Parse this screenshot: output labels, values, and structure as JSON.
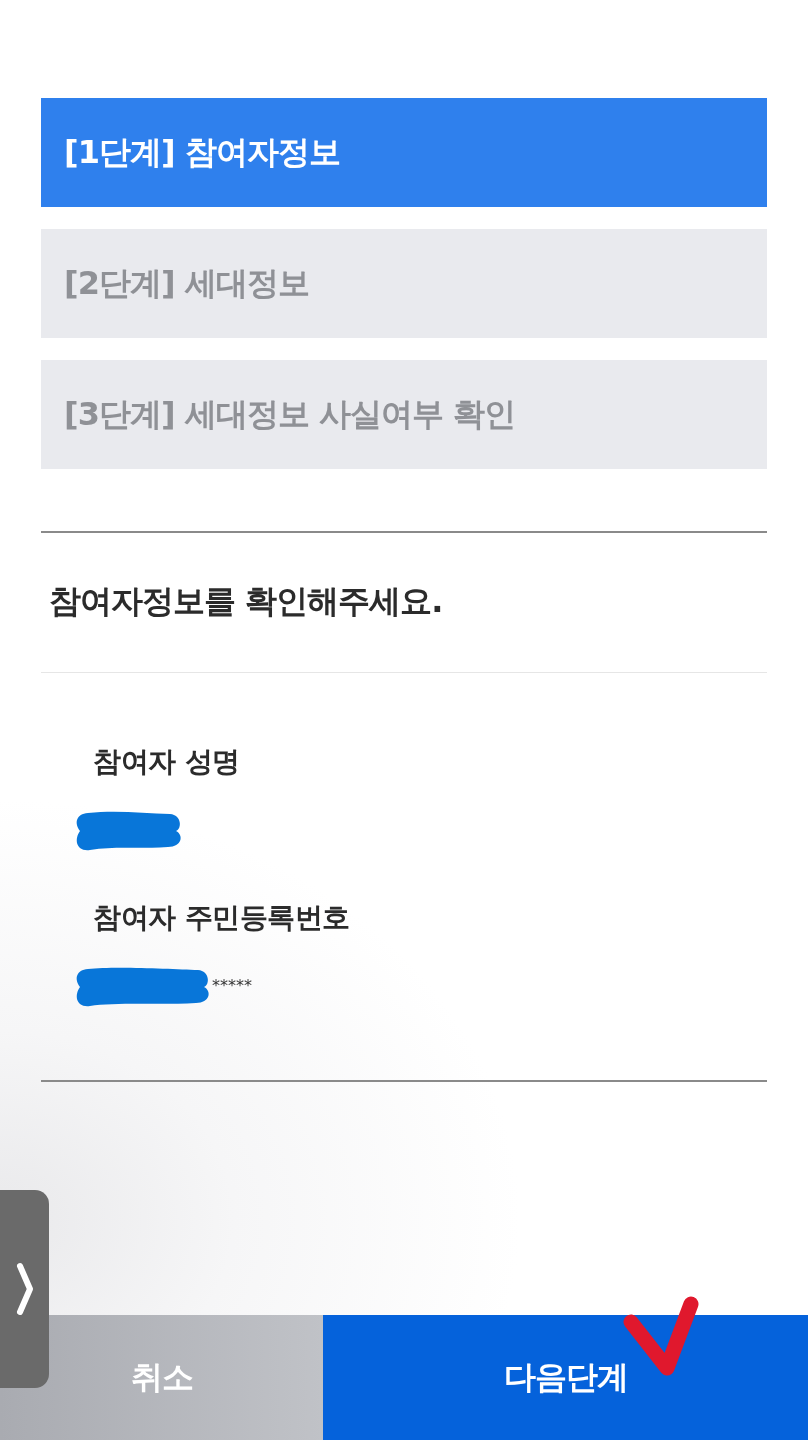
{
  "steps": [
    {
      "label": "[1단계] 참여자정보",
      "selected": true
    },
    {
      "label": "[2단계] 세대정보",
      "selected": false
    },
    {
      "label": "[3단계] 세대정보 사실여부 확인",
      "selected": false
    }
  ],
  "heading": "참여자정보를 확인해주세요.",
  "fields": [
    {
      "label": "참여자 성명",
      "redacted": true
    },
    {
      "label": "참여자 주민등록번호",
      "redacted": true,
      "value": "*****"
    }
  ],
  "buttons": [
    {
      "label": "취소",
      "kind": "secondary",
      "marked": false
    },
    {
      "label": "다음단계",
      "kind": "primary",
      "marked": true
    }
  ]
}
